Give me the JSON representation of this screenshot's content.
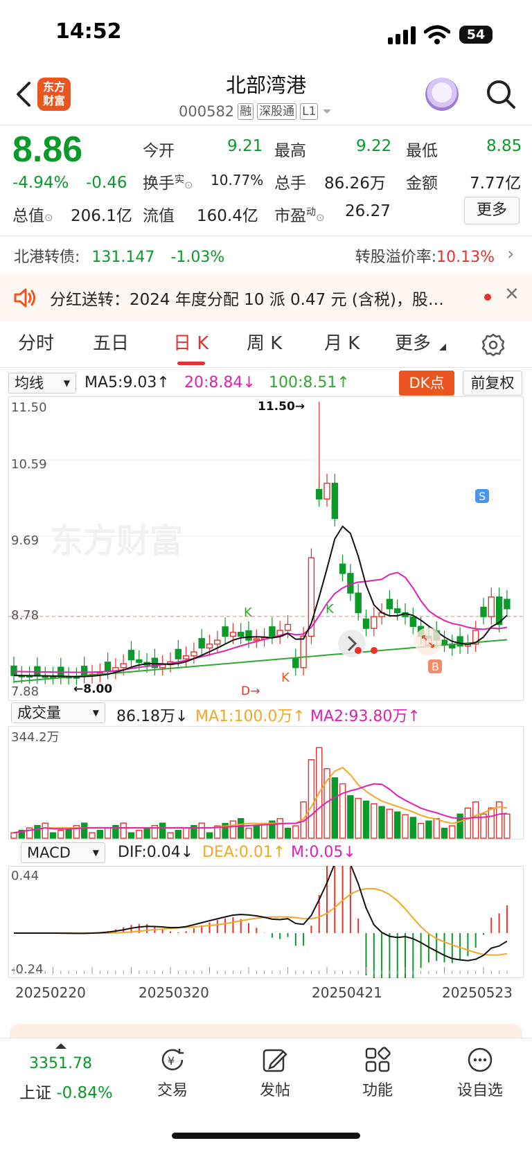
{
  "status_bar": {
    "time": "14:52",
    "battery": "54"
  },
  "header": {
    "app_logo": "东方\n财富",
    "title": "北部湾港",
    "code": "000582",
    "tags": [
      "融",
      "深股通",
      "L1"
    ]
  },
  "quote": {
    "price": "8.86",
    "change_pct": "-4.94%",
    "change": "-0.46",
    "open_label": "今开",
    "open": "9.21",
    "high_label": "最高",
    "high": "9.22",
    "low_label": "最低",
    "low": "8.85",
    "turnover_label": "换手",
    "turnover_sup": "实",
    "turnover": "10.77%",
    "volume_label": "总手",
    "volume": "86.26万",
    "amount_label": "金额",
    "amount": "7.77亿",
    "mktcap_label": "总值",
    "mktcap": "206.1亿",
    "float_label": "流值",
    "float": "160.4亿",
    "pe_label": "市盈",
    "pe_sup": "动",
    "pe": "26.27",
    "more": "更多"
  },
  "bond": {
    "label": "北港转债:",
    "price": "131.147",
    "change": "-1.03%",
    "premium_label": "转股溢价率:",
    "premium": "10.13%"
  },
  "notice": {
    "text": "分红送转：2024 年度分配 10 派 0.47 元 (含税)，股…"
  },
  "tabs": [
    "分时",
    "五日",
    "日 K",
    "周 K",
    "月 K",
    "更多"
  ],
  "kline": {
    "selector": "均线",
    "ma5": "MA5:9.03↑",
    "ma20": "20:8.84↓",
    "ma100": "100:8.51↑",
    "dk_button": "DK点",
    "adjust_button": "前复权",
    "y_labels": [
      "11.50",
      "10.59",
      "9.69",
      "8.78",
      "7.88"
    ],
    "max_marker": "11.50→",
    "min_marker": "←8.00",
    "signals": [
      "K",
      "K",
      "D→",
      "K",
      "D",
      "B",
      "S"
    ],
    "watermark": "东方财富"
  },
  "volume": {
    "selector": "成交量",
    "value": "86.18万↓",
    "ma1": "MA1:100.0万↑",
    "ma2": "MA2:93.80万↑",
    "y_label": "344.2万"
  },
  "macd": {
    "selector": "MACD",
    "dif": "DIF:0.04↓",
    "dea": "DEA:0.01↑",
    "m": "M:0.05↓",
    "y_top": "0.44",
    "y_bottom": "-0.24"
  },
  "dates": [
    "20250220",
    "20250320",
    "20250421",
    "20250523"
  ],
  "bottom_nav": {
    "index_value": "3351.78",
    "index_name": "上证",
    "index_change": "-0.84%",
    "items": [
      "交易",
      "发帖",
      "功能",
      "设自选"
    ]
  },
  "colors": {
    "up": "#e8302c",
    "down": "#0a9a2a",
    "accent": "#ea5520",
    "ma5": "#111111",
    "ma20": "#e020b0",
    "ma100": "#2ea82e",
    "ma1": "#f5a623"
  }
}
